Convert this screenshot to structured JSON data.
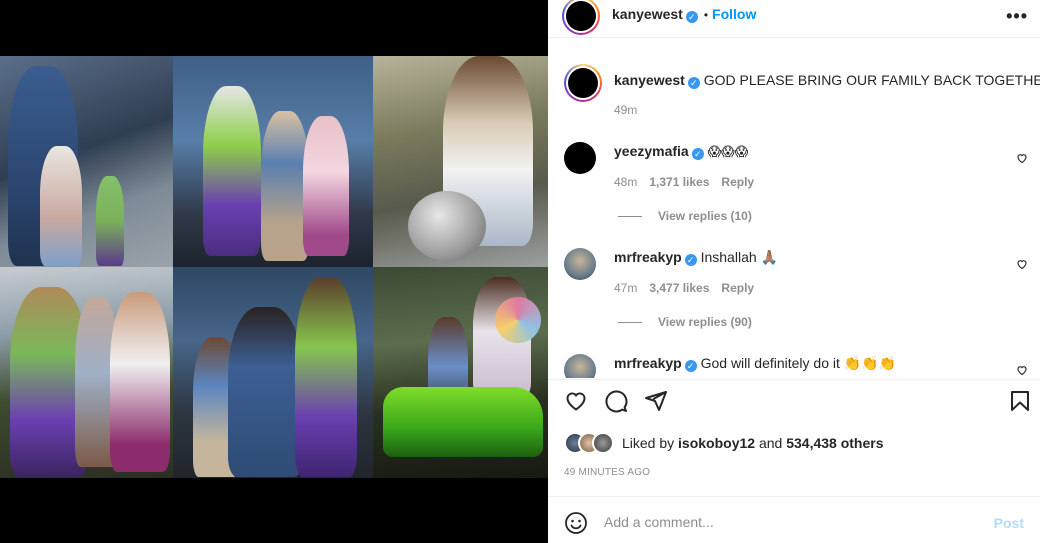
{
  "post": {
    "author": "kanyewest",
    "follow_label": "Follow",
    "separator": "•",
    "more_label": "•••",
    "verified_mark": "✓",
    "caption": {
      "username": "kanyewest",
      "text": "GOD PLEASE BRING OUR FAMILY BACK TOGETHER",
      "time": "49m"
    },
    "comments": [
      {
        "username": "yeezymafia",
        "text": "😱😱😱",
        "time": "48m",
        "likes": "1,371 likes",
        "reply_label": "Reply",
        "view_replies": "View replies (10)"
      },
      {
        "username": "mrfreakyp",
        "text": "Inshallah 🙏🏽",
        "time": "47m",
        "likes": "3,477 likes",
        "reply_label": "Reply",
        "view_replies": "View replies (90)"
      },
      {
        "username": "mrfreakyp",
        "text": "God will definitely do it 👏👏👏"
      }
    ],
    "liked_by_prefix": "Liked by ",
    "liked_by_user": "isokoboy12",
    "liked_by_middle": " and ",
    "liked_by_count": "534,438 others",
    "timestamp": "49 MINUTES AGO",
    "add_comment_placeholder": "Add a comment...",
    "post_label": "Post"
  },
  "icons": {
    "like": "heart-icon",
    "comment": "comment-icon",
    "share": "share-icon",
    "save": "bookmark-icon",
    "emoji": "smiley-icon",
    "more": "more-icon"
  },
  "colors": {
    "accent": "#0095f6",
    "verified": "#3897f0",
    "muted": "#8e8e8e",
    "post_disabled": "#b3dbff"
  }
}
